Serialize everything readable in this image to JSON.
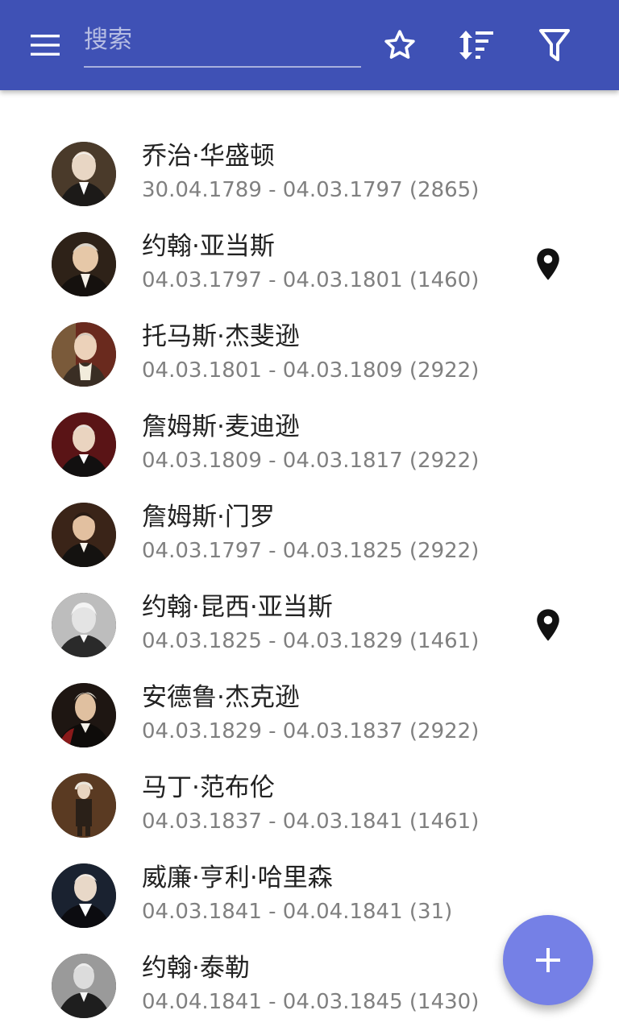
{
  "header": {
    "search_placeholder": "搜索",
    "icons": [
      "menu-icon",
      "star-outline-icon",
      "sort-icon",
      "filter-icon"
    ],
    "background_color": "#3f51b5"
  },
  "presidents": [
    {
      "name": "乔治·华盛顿",
      "dates": "30.04.1789 - 04.03.1797 (2865)",
      "pinned": false
    },
    {
      "name": "约翰·亚当斯",
      "dates": "04.03.1797 - 04.03.1801 (1460)",
      "pinned": true
    },
    {
      "name": "托马斯·杰斐逊",
      "dates": "04.03.1801 - 04.03.1809 (2922)",
      "pinned": false
    },
    {
      "name": "詹姆斯·麦迪逊",
      "dates": "04.03.1809 - 04.03.1817 (2922)",
      "pinned": false
    },
    {
      "name": "詹姆斯·门罗",
      "dates": "04.03.1797 - 04.03.1825 (2922)",
      "pinned": false
    },
    {
      "name": "约翰·昆西·亚当斯",
      "dates": "04.03.1825 - 04.03.1829 (1461)",
      "pinned": true
    },
    {
      "name": "安德鲁·杰克逊",
      "dates": "04.03.1829 - 04.03.1837 (2922)",
      "pinned": false
    },
    {
      "name": "马丁·范布伦",
      "dates": "04.03.1837 - 04.03.1841 (1461)",
      "pinned": false
    },
    {
      "name": "威廉·亨利·哈里森",
      "dates": "04.03.1841 - 04.04.1841 (31)",
      "pinned": false
    },
    {
      "name": "约翰·泰勒",
      "dates": "04.04.1841 - 04.03.1845 (1430)",
      "pinned": false
    }
  ],
  "fab": {
    "icon": "plus-icon",
    "color": "#7580e6"
  },
  "colors": {
    "name_text": "#222222",
    "date_text": "#808080",
    "pin": "#111111"
  }
}
